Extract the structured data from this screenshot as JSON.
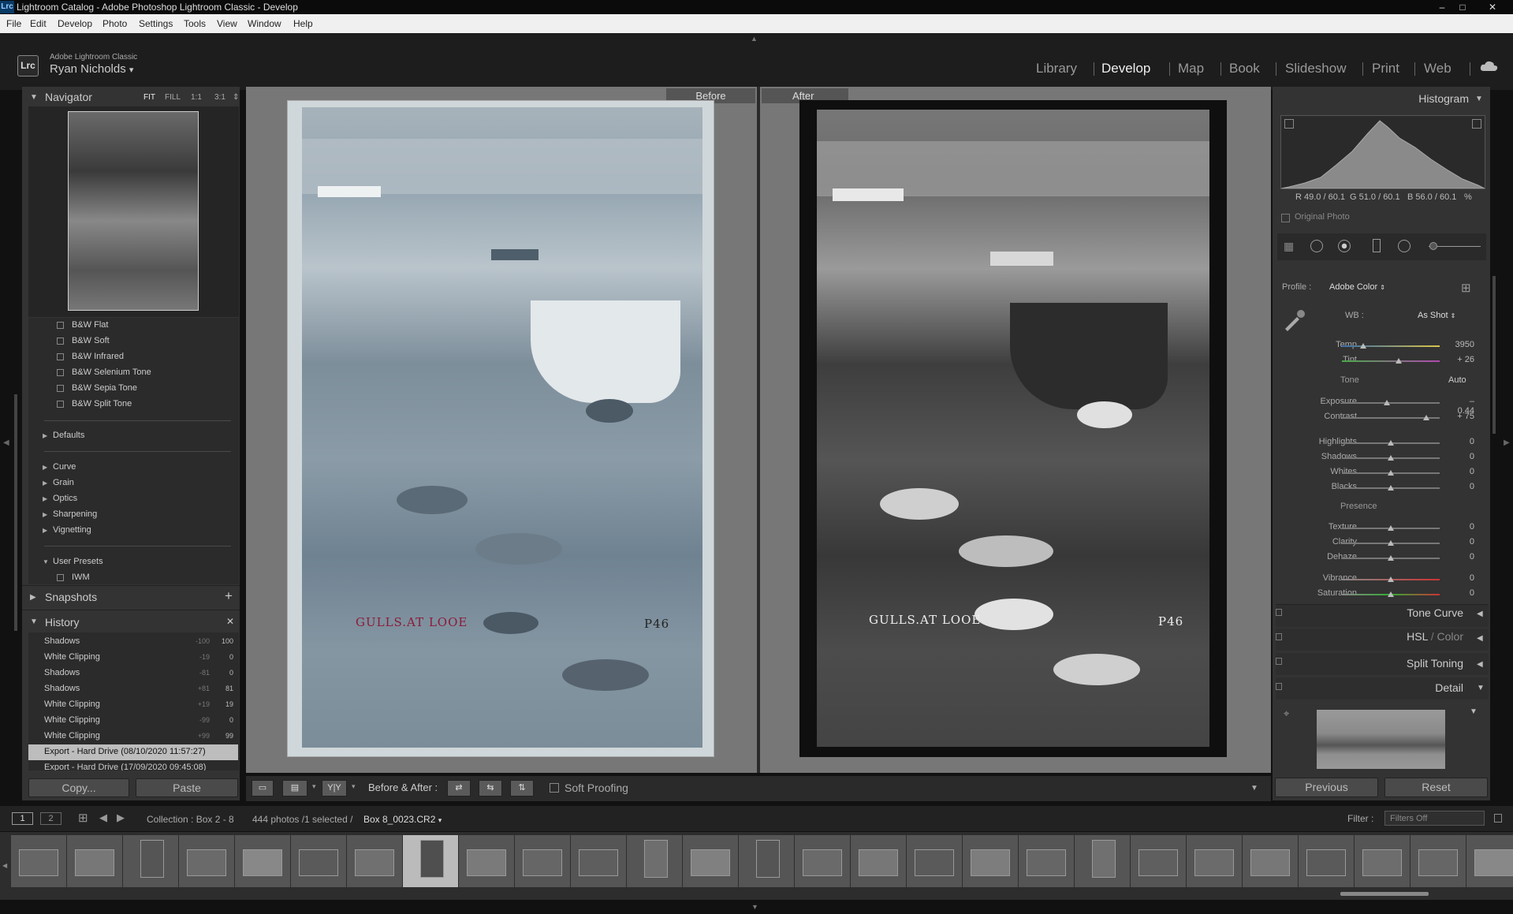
{
  "window": {
    "icon_label": "Lrc",
    "title": "Lightroom Catalog - Adobe Photoshop Lightroom Classic - Develop",
    "controls": [
      "–",
      "□",
      "✕"
    ]
  },
  "menu": [
    "File",
    "Edit",
    "Develop",
    "Photo",
    "Settings",
    "Tools",
    "View",
    "Window",
    "Help"
  ],
  "identity": {
    "logo": "Lrc",
    "app": "Adobe Lightroom Classic",
    "user": "Ryan Nicholds",
    "user_caret": "▾"
  },
  "modules": [
    {
      "label": "Library",
      "active": false
    },
    {
      "label": "Develop",
      "active": true
    },
    {
      "label": "Map",
      "active": false
    },
    {
      "label": "Book",
      "active": false
    },
    {
      "label": "Slideshow",
      "active": false
    },
    {
      "label": "Print",
      "active": false
    },
    {
      "label": "Web",
      "active": false
    }
  ],
  "navigator": {
    "title": "Navigator",
    "opts": [
      "FIT",
      "FILL",
      "1:1",
      "3:1"
    ]
  },
  "presets": {
    "items": [
      "B&W Flat",
      "B&W Soft",
      "B&W Infrared",
      "B&W Selenium Tone",
      "B&W Sepia Tone",
      "B&W Split Tone"
    ],
    "groups": [
      "Defaults",
      "Curve",
      "Grain",
      "Optics",
      "Sharpening",
      "Vignetting"
    ],
    "user_presets": "User Presets",
    "user_items": [
      "IWM"
    ]
  },
  "snapshots": {
    "title": "Snapshots",
    "add": "+"
  },
  "history": {
    "title": "History",
    "close": "✕",
    "rows": [
      {
        "name": "Shadows",
        "a": "-100",
        "b": "100"
      },
      {
        "name": "White Clipping",
        "a": "-19",
        "b": "0"
      },
      {
        "name": "Shadows",
        "a": "-81",
        "b": "0"
      },
      {
        "name": "Shadows",
        "a": "+81",
        "b": "81"
      },
      {
        "name": "White Clipping",
        "a": "+19",
        "b": "19"
      },
      {
        "name": "White Clipping",
        "a": "-99",
        "b": "0"
      },
      {
        "name": "White Clipping",
        "a": "+99",
        "b": "99"
      },
      {
        "name": "Export - Hard Drive (08/10/2020 11:57:27)",
        "a": "",
        "b": ""
      },
      {
        "name": "Export - Hard Drive (17/09/2020 09:45:08)",
        "a": "",
        "b": ""
      }
    ]
  },
  "left_buttons": {
    "copy": "Copy...",
    "paste": "Paste"
  },
  "before_label": "Before",
  "after_label": "After",
  "captions": {
    "left": "GULLS.AT LOOE",
    "right": "P46"
  },
  "toolbar": {
    "yy": "Y|Y",
    "before_after": "Before & After :",
    "soft_proofing": "Soft Proofing"
  },
  "histogram": {
    "title": "Histogram",
    "r": "R  49.0 / 60.1",
    "g": "G  51.0 / 60.1",
    "b": "B  56.0 / 60.1",
    "pct": "%",
    "original": "Original Photo"
  },
  "basic": {
    "profile_label": "Profile :",
    "profile_value": "Adobe Color",
    "wb_label": "WB :",
    "wb_value": "As Shot",
    "tone_label": "Tone",
    "auto": "Auto",
    "presence_label": "Presence",
    "sliders": [
      {
        "label": "Temp",
        "value": "3950",
        "pos": 0.22
      },
      {
        "label": "Tint",
        "value": "+ 26",
        "pos": 0.58
      },
      {
        "label": "Exposure",
        "value": "– 0.44",
        "pos": 0.46
      },
      {
        "label": "Contrast",
        "value": "+ 75",
        "pos": 0.86
      },
      {
        "label": "Highlights",
        "value": "0",
        "pos": 0.5
      },
      {
        "label": "Shadows",
        "value": "0",
        "pos": 0.5
      },
      {
        "label": "Whites",
        "value": "0",
        "pos": 0.5
      },
      {
        "label": "Blacks",
        "value": "0",
        "pos": 0.5
      },
      {
        "label": "Texture",
        "value": "0",
        "pos": 0.5
      },
      {
        "label": "Clarity",
        "value": "0",
        "pos": 0.5
      },
      {
        "label": "Dehaze",
        "value": "0",
        "pos": 0.5
      },
      {
        "label": "Vibrance",
        "value": "0",
        "pos": 0.5
      },
      {
        "label": "Saturation",
        "value": "0",
        "pos": 0.5
      }
    ]
  },
  "panels": {
    "tone_curve": "Tone Curve",
    "hsl": "HSL",
    "slash": "/",
    "color": "Color",
    "split_toning": "Split Toning",
    "detail": "Detail"
  },
  "right_buttons": {
    "previous": "Previous",
    "reset": "Reset"
  },
  "filmbar": {
    "page1": "1",
    "page2": "2",
    "collection": "Collection : Box 2 - 8",
    "count": "444 photos /1 selected /",
    "file": "Box 8_0023.CR2",
    "filter_label": "Filter :",
    "filter_value": "Filters Off"
  },
  "colors": {
    "accent_before_tint": "#93a4b0",
    "caption_red": "#8a1c3a",
    "panel_bg": "#333333"
  }
}
